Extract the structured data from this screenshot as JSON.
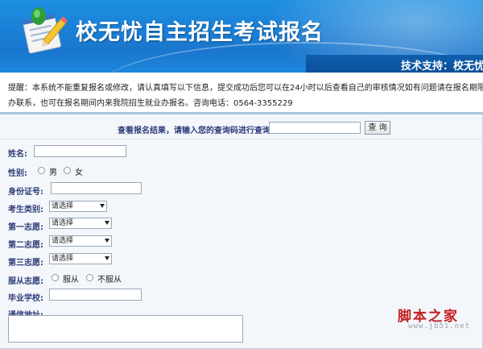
{
  "header": {
    "title": "校无忧自主招生考试报名",
    "support": "技术支持：校无忧"
  },
  "notice": {
    "line1": "提醒：本系统不能重复报名或修改，请认真填写以下信息，提交成功后您可以在24小时以后查看自己的审核情况如有问题请在报名期限内与我院",
    "line2": "办联系，也可在报名期间内来我院招生就业办报名。咨询电话：0564-3355229"
  },
  "query": {
    "label": "查看报名结果，请输入您的查询码进行查询：",
    "button": "查 询"
  },
  "form": {
    "name_label": "姓名:",
    "gender_label": "性别:",
    "gender_male": "男",
    "gender_female": "女",
    "id_label": "身份证号:",
    "category_label": "考生类别:",
    "choice1_label": "第一志愿:",
    "choice2_label": "第二志愿:",
    "choice3_label": "第三志愿:",
    "select_placeholder": "请选择",
    "obey_label": "服从志愿:",
    "obey_yes": "服从",
    "obey_no": "不服从",
    "school_label": "毕业学校:",
    "address_label": "通信地址:"
  },
  "watermark": {
    "brand": "脚本之家",
    "url": "www.jb51.net"
  },
  "colors": {
    "banner": "#1a7fd6",
    "label": "#2e3c78",
    "watermark": "#c32020"
  }
}
